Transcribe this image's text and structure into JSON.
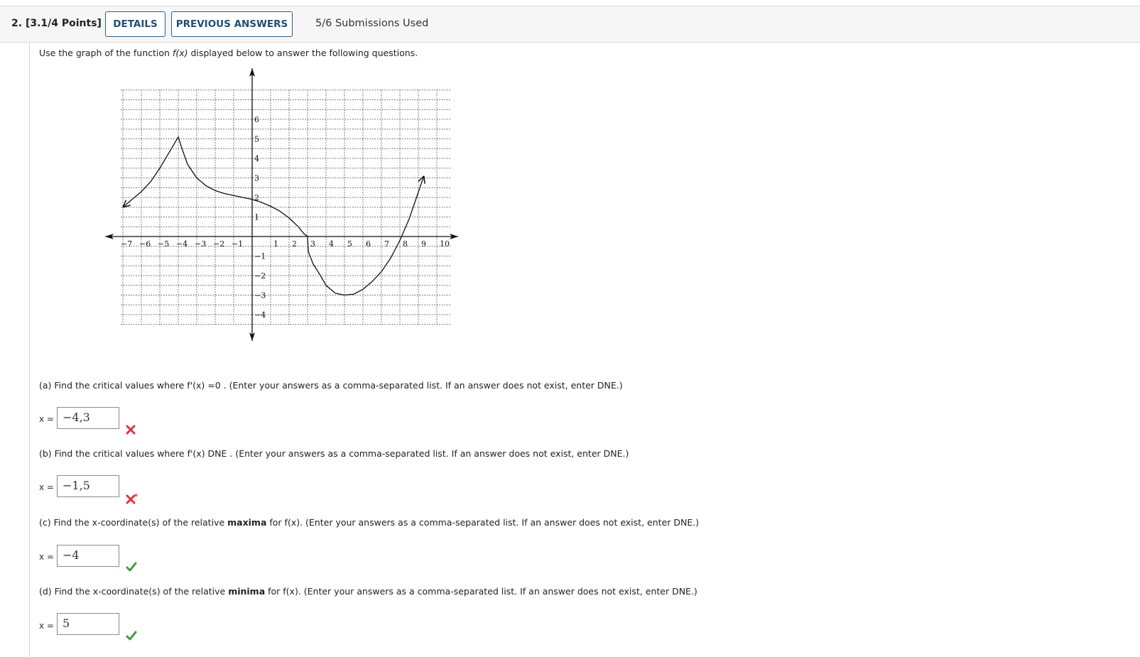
{
  "header": {
    "question_number": "2.",
    "points": "[3.1/4 Points]",
    "details_label": "DETAILS",
    "previous_answers_label": "PREVIOUS ANSWERS",
    "submissions": "5/6 Submissions Used"
  },
  "prompt": {
    "before": "Use the graph of the function ",
    "func": "f(x)",
    "after": " displayed below to answer the following questions."
  },
  "graph": {
    "x_ticks": [
      "-7",
      "-6",
      "-5",
      "-4",
      "-3",
      "-2",
      "-1",
      "1",
      "2",
      "3",
      "4",
      "5",
      "6",
      "7",
      "8",
      "9",
      "10"
    ],
    "y_ticks": [
      "6",
      "5",
      "4",
      "3",
      "2",
      "1",
      "-1",
      "-2",
      "-3",
      "-4"
    ],
    "x_range": [
      -7,
      10
    ],
    "y_range": [
      -4,
      6
    ],
    "curve_points": [
      [
        -7,
        1.5
      ],
      [
        -6.5,
        1.9
      ],
      [
        -6,
        2.3
      ],
      [
        -5.5,
        2.8
      ],
      [
        -5,
        3.5
      ],
      [
        -4.5,
        4.3
      ],
      [
        -4,
        5.1
      ],
      [
        -3.8,
        4.5
      ],
      [
        -3.5,
        3.7
      ],
      [
        -3,
        3.0
      ],
      [
        -2.5,
        2.6
      ],
      [
        -2,
        2.35
      ],
      [
        -1.5,
        2.2
      ],
      [
        -1,
        2.1
      ],
      [
        0,
        1.9
      ],
      [
        0.5,
        1.75
      ],
      [
        1,
        1.55
      ],
      [
        1.5,
        1.3
      ],
      [
        2,
        0.95
      ],
      [
        2.5,
        0.5
      ],
      [
        2.8,
        0.15
      ],
      [
        3,
        0
      ],
      [
        3.02,
        -0.4
      ],
      [
        3.05,
        -0.8
      ],
      [
        3.3,
        -1.4
      ],
      [
        3.7,
        -2.0
      ],
      [
        4,
        -2.5
      ],
      [
        4.5,
        -2.9
      ],
      [
        5,
        -3.0
      ],
      [
        5.5,
        -2.95
      ],
      [
        6,
        -2.7
      ],
      [
        6.5,
        -2.3
      ],
      [
        7,
        -1.8
      ],
      [
        7.5,
        -1.1
      ],
      [
        8,
        -0.2
      ],
      [
        8.5,
        0.9
      ],
      [
        8.9,
        2.0
      ],
      [
        9.3,
        3.1
      ]
    ]
  },
  "parts": [
    {
      "text_before": "(a) Find the critical values where  f'(x) ",
      "emph": "=0",
      "text_after": " . (Enter your answers as a comma-separated list. If an answer does not exist, enter DNE.)",
      "x_label": "x =",
      "answer": "−4,3",
      "status": "incorrect"
    },
    {
      "text_before": "(b) Find the critical values where  f'(x) ",
      "emph": "DNE",
      "text_after": " . (Enter your answers as a comma-separated list. If an answer does not exist, enter DNE.)",
      "x_label": "x =",
      "answer": "−1,5",
      "status": "incorrect-partial"
    },
    {
      "text_before": "(c) Find the x-coordinate(s) of the relative ",
      "emph": "maxima",
      "text_after": " for f(x). (Enter your answers as a comma-separated list. If an answer does not exist, enter DNE.)",
      "x_label": "x =",
      "answer": "−4",
      "status": "correct"
    },
    {
      "text_before": "(d) Find the x-coordinate(s) of the relative ",
      "emph": "minima",
      "text_after": " for f(x). (Enter your answers as a comma-separated list. If an answer does not exist, enter DNE.)",
      "x_label": "x =",
      "answer": "5",
      "status": "correct"
    }
  ],
  "colors": {
    "incorrect": "#e0323c",
    "correct": "#3c9a3c",
    "button_border": "#2a5d8a",
    "button_text": "#1d4e7a"
  }
}
